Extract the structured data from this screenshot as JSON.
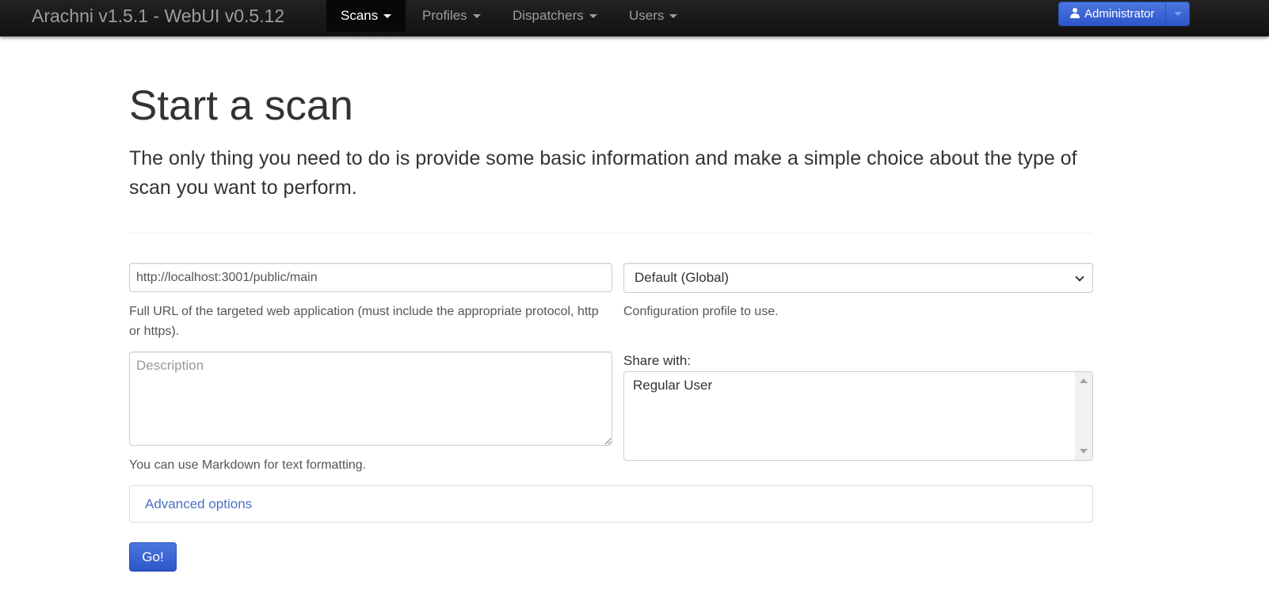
{
  "navbar": {
    "brand": "Arachni v1.5.1 - WebUI v0.5.12",
    "items": [
      {
        "label": "Scans",
        "active": true
      },
      {
        "label": "Profiles",
        "active": false
      },
      {
        "label": "Dispatchers",
        "active": false
      },
      {
        "label": "Users",
        "active": false
      }
    ],
    "user_button": "Administrator"
  },
  "main": {
    "title": "Start a scan",
    "lead": "The only thing you need to do is provide some basic information and make a simple choice about the type of scan you want to perform.",
    "url": {
      "value": "http://localhost:3001/public/main",
      "help": "Full URL of the targeted web application (must include the appropriate protocol, http or https)."
    },
    "description": {
      "placeholder": "Description",
      "help": "You can use Markdown for text formatting."
    },
    "profile": {
      "selected": "Default (Global)",
      "help": "Configuration profile to use."
    },
    "share": {
      "label": "Share with:",
      "options": [
        "Regular User"
      ]
    },
    "advanced_label": "Advanced options",
    "submit_label": "Go!"
  },
  "colors": {
    "navbar_bg": "#111111",
    "primary_button": "#2d56c9",
    "link": "#4b72c4"
  }
}
